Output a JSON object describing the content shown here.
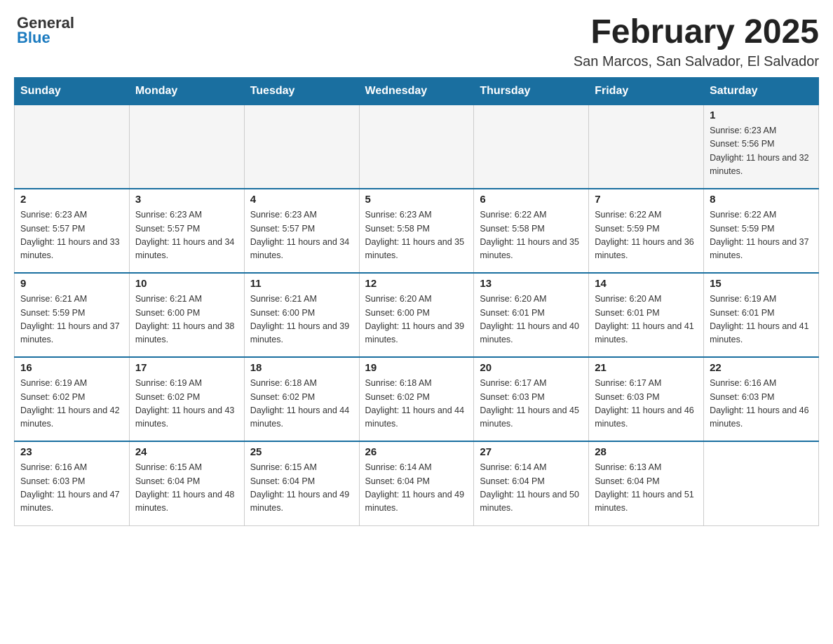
{
  "header": {
    "logo_general": "General",
    "logo_blue": "Blue",
    "month_title": "February 2025",
    "location": "San Marcos, San Salvador, El Salvador"
  },
  "days_of_week": [
    "Sunday",
    "Monday",
    "Tuesday",
    "Wednesday",
    "Thursday",
    "Friday",
    "Saturday"
  ],
  "weeks": [
    [
      {
        "day": "",
        "sunrise": "",
        "sunset": "",
        "daylight": ""
      },
      {
        "day": "",
        "sunrise": "",
        "sunset": "",
        "daylight": ""
      },
      {
        "day": "",
        "sunrise": "",
        "sunset": "",
        "daylight": ""
      },
      {
        "day": "",
        "sunrise": "",
        "sunset": "",
        "daylight": ""
      },
      {
        "day": "",
        "sunrise": "",
        "sunset": "",
        "daylight": ""
      },
      {
        "day": "",
        "sunrise": "",
        "sunset": "",
        "daylight": ""
      },
      {
        "day": "1",
        "sunrise": "Sunrise: 6:23 AM",
        "sunset": "Sunset: 5:56 PM",
        "daylight": "Daylight: 11 hours and 32 minutes."
      }
    ],
    [
      {
        "day": "2",
        "sunrise": "Sunrise: 6:23 AM",
        "sunset": "Sunset: 5:57 PM",
        "daylight": "Daylight: 11 hours and 33 minutes."
      },
      {
        "day": "3",
        "sunrise": "Sunrise: 6:23 AM",
        "sunset": "Sunset: 5:57 PM",
        "daylight": "Daylight: 11 hours and 34 minutes."
      },
      {
        "day": "4",
        "sunrise": "Sunrise: 6:23 AM",
        "sunset": "Sunset: 5:57 PM",
        "daylight": "Daylight: 11 hours and 34 minutes."
      },
      {
        "day": "5",
        "sunrise": "Sunrise: 6:23 AM",
        "sunset": "Sunset: 5:58 PM",
        "daylight": "Daylight: 11 hours and 35 minutes."
      },
      {
        "day": "6",
        "sunrise": "Sunrise: 6:22 AM",
        "sunset": "Sunset: 5:58 PM",
        "daylight": "Daylight: 11 hours and 35 minutes."
      },
      {
        "day": "7",
        "sunrise": "Sunrise: 6:22 AM",
        "sunset": "Sunset: 5:59 PM",
        "daylight": "Daylight: 11 hours and 36 minutes."
      },
      {
        "day": "8",
        "sunrise": "Sunrise: 6:22 AM",
        "sunset": "Sunset: 5:59 PM",
        "daylight": "Daylight: 11 hours and 37 minutes."
      }
    ],
    [
      {
        "day": "9",
        "sunrise": "Sunrise: 6:21 AM",
        "sunset": "Sunset: 5:59 PM",
        "daylight": "Daylight: 11 hours and 37 minutes."
      },
      {
        "day": "10",
        "sunrise": "Sunrise: 6:21 AM",
        "sunset": "Sunset: 6:00 PM",
        "daylight": "Daylight: 11 hours and 38 minutes."
      },
      {
        "day": "11",
        "sunrise": "Sunrise: 6:21 AM",
        "sunset": "Sunset: 6:00 PM",
        "daylight": "Daylight: 11 hours and 39 minutes."
      },
      {
        "day": "12",
        "sunrise": "Sunrise: 6:20 AM",
        "sunset": "Sunset: 6:00 PM",
        "daylight": "Daylight: 11 hours and 39 minutes."
      },
      {
        "day": "13",
        "sunrise": "Sunrise: 6:20 AM",
        "sunset": "Sunset: 6:01 PM",
        "daylight": "Daylight: 11 hours and 40 minutes."
      },
      {
        "day": "14",
        "sunrise": "Sunrise: 6:20 AM",
        "sunset": "Sunset: 6:01 PM",
        "daylight": "Daylight: 11 hours and 41 minutes."
      },
      {
        "day": "15",
        "sunrise": "Sunrise: 6:19 AM",
        "sunset": "Sunset: 6:01 PM",
        "daylight": "Daylight: 11 hours and 41 minutes."
      }
    ],
    [
      {
        "day": "16",
        "sunrise": "Sunrise: 6:19 AM",
        "sunset": "Sunset: 6:02 PM",
        "daylight": "Daylight: 11 hours and 42 minutes."
      },
      {
        "day": "17",
        "sunrise": "Sunrise: 6:19 AM",
        "sunset": "Sunset: 6:02 PM",
        "daylight": "Daylight: 11 hours and 43 minutes."
      },
      {
        "day": "18",
        "sunrise": "Sunrise: 6:18 AM",
        "sunset": "Sunset: 6:02 PM",
        "daylight": "Daylight: 11 hours and 44 minutes."
      },
      {
        "day": "19",
        "sunrise": "Sunrise: 6:18 AM",
        "sunset": "Sunset: 6:02 PM",
        "daylight": "Daylight: 11 hours and 44 minutes."
      },
      {
        "day": "20",
        "sunrise": "Sunrise: 6:17 AM",
        "sunset": "Sunset: 6:03 PM",
        "daylight": "Daylight: 11 hours and 45 minutes."
      },
      {
        "day": "21",
        "sunrise": "Sunrise: 6:17 AM",
        "sunset": "Sunset: 6:03 PM",
        "daylight": "Daylight: 11 hours and 46 minutes."
      },
      {
        "day": "22",
        "sunrise": "Sunrise: 6:16 AM",
        "sunset": "Sunset: 6:03 PM",
        "daylight": "Daylight: 11 hours and 46 minutes."
      }
    ],
    [
      {
        "day": "23",
        "sunrise": "Sunrise: 6:16 AM",
        "sunset": "Sunset: 6:03 PM",
        "daylight": "Daylight: 11 hours and 47 minutes."
      },
      {
        "day": "24",
        "sunrise": "Sunrise: 6:15 AM",
        "sunset": "Sunset: 6:04 PM",
        "daylight": "Daylight: 11 hours and 48 minutes."
      },
      {
        "day": "25",
        "sunrise": "Sunrise: 6:15 AM",
        "sunset": "Sunset: 6:04 PM",
        "daylight": "Daylight: 11 hours and 49 minutes."
      },
      {
        "day": "26",
        "sunrise": "Sunrise: 6:14 AM",
        "sunset": "Sunset: 6:04 PM",
        "daylight": "Daylight: 11 hours and 49 minutes."
      },
      {
        "day": "27",
        "sunrise": "Sunrise: 6:14 AM",
        "sunset": "Sunset: 6:04 PM",
        "daylight": "Daylight: 11 hours and 50 minutes."
      },
      {
        "day": "28",
        "sunrise": "Sunrise: 6:13 AM",
        "sunset": "Sunset: 6:04 PM",
        "daylight": "Daylight: 11 hours and 51 minutes."
      },
      {
        "day": "",
        "sunrise": "",
        "sunset": "",
        "daylight": ""
      }
    ]
  ]
}
